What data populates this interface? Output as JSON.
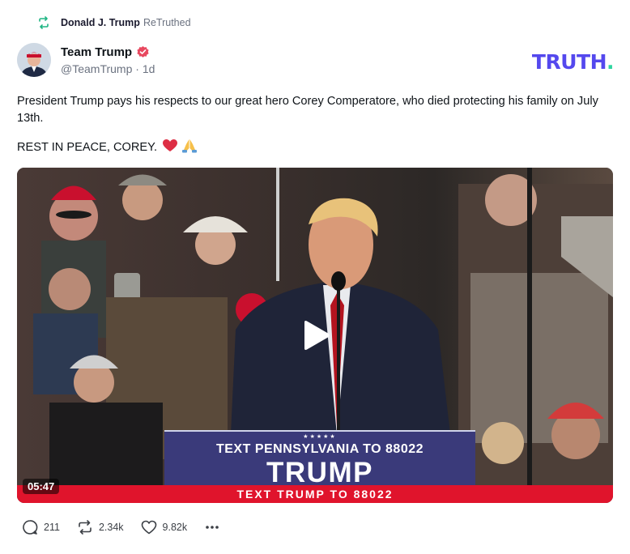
{
  "retruth": {
    "icon": "retruth-icon",
    "user": "Donald J. Trump",
    "verb": "ReTruthed"
  },
  "author": {
    "name": "Team Trump",
    "handle": "@TeamTrump",
    "separator": "·",
    "time": "1d",
    "verified": true
  },
  "brand": {
    "logo_text": "TRUTH",
    "logo_dot": ".",
    "color": "#5448ee",
    "dot_color": "#2fd5a0"
  },
  "post": {
    "paragraph1": "President Trump pays his respects to our great hero Corey Comperatore, who died protecting his family on July 13th.",
    "paragraph2": "REST IN PEACE, COREY."
  },
  "video": {
    "duration": "05:47",
    "banner_stars": "★★★★★",
    "banner_line1": "TEXT PENNSYLVANIA TO 88022",
    "banner_line2": "TRUMP",
    "strip_text": "TEXT TRUMP TO 88022"
  },
  "actions": {
    "replies": "211",
    "retruths": "2.34k",
    "likes": "9.82k"
  }
}
